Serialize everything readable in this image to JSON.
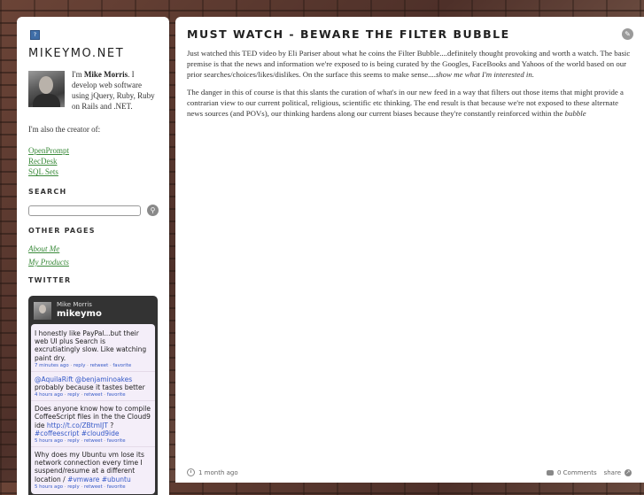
{
  "sidebar": {
    "site_title": "MIKEYMO.NET",
    "logo_glyph": "?",
    "bio": {
      "prefix": "I'm ",
      "name": "Mike Morris",
      "suffix": ". I develop web software using jQuery, Ruby, Ruby on Rails and .NET."
    },
    "creator_text": "I'm also the creator of:",
    "creator_links": [
      "OpenPrompt",
      "RecDesk",
      "SQL Sets"
    ],
    "search_heading": "SEARCH",
    "search_placeholder": "",
    "other_pages_heading": "OTHER PAGES",
    "other_pages": [
      "About Me",
      "My Products"
    ],
    "twitter_heading": "TWITTER",
    "twitter": {
      "name": "Mike Morris",
      "handle": "mikeymo",
      "tweets": [
        {
          "text": "I honestly like PayPal...but their web UI plus Search is excrutiatingly slow. Like watching paint dry.",
          "time": "7 minutes ago",
          "reply": "reply",
          "retweet": "retweet",
          "favorite": "favorite"
        },
        {
          "mention1": "@AquilaRift",
          "mention2": "@benjaminoakes",
          "text": "probably because it tastes better",
          "time": "4 hours ago",
          "reply": "reply",
          "retweet": "retweet",
          "favorite": "favorite"
        },
        {
          "text": "Does anyone know how to compile CoffeeScript files in the the Cloud9 ide ",
          "link": "http://t.co/ZBtmIJT",
          "text2": " ? ",
          "hash1": "#coffeescript",
          "hash2": "#cloud9ide",
          "time": "5 hours ago",
          "reply": "reply",
          "retweet": "retweet",
          "favorite": "favorite"
        },
        {
          "text": "Why does my Ubuntu vm lose its network connection every time I suspend/resume at a different location / ",
          "hash1": "#vmware",
          "hash2": "#ubuntu",
          "time": "5 hours ago",
          "reply": "reply",
          "retweet": "retweet",
          "favorite": "favorite"
        }
      ]
    }
  },
  "post": {
    "title": "MUST WATCH - BEWARE THE FILTER BUBBLE",
    "p1": "Just watched this TED video by Eli Pariser about what he coins the Filter Bubble....definitely thought provoking and worth a watch. The basic premise is that the news and information we're exposed to is being curated by the Googles, FaceBooks and Yahoos of the world based on our prior searches/choices/likes/dislikes. On the surface this seems to make sense....",
    "p1_em": "show me what I'm interested in.",
    "p2": "The danger in this of course is that this slants the curation of what's in our new feed in a way that filters out those items that might provide a contrarian view to our current political, religious, scientific etc thinking. The end result is that because we're not exposed to these alternate news sources (and POVs), our thinking hardens along our current biases because they're constantly reinforced within the ",
    "p2_em": "bubble",
    "time_ago": "1 month ago",
    "comments": "0 Comments",
    "share": "share"
  },
  "colors": {
    "link_green": "#3a8a3a",
    "twitter_link": "#3559c7",
    "twitter_box": "#333333"
  }
}
